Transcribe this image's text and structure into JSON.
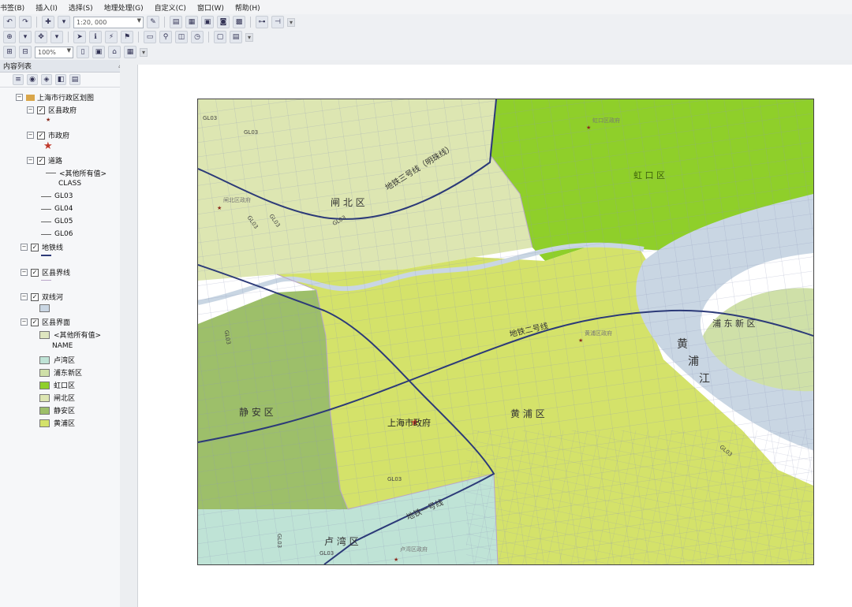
{
  "menu": [
    "书签(B)",
    "插入(I)",
    "选择(S)",
    "地理处理(G)",
    "自定义(C)",
    "窗口(W)",
    "帮助(H)"
  ],
  "toolbar": {
    "scale_value": "1:20, 000",
    "zoom_value": "100%"
  },
  "toc": {
    "title": "内容列表",
    "pin_glyph": "₄",
    "close_glyph": "×",
    "map_doc": "上海市行政区划图",
    "layers": {
      "county_gov": {
        "name": "区县政府"
      },
      "city_gov": {
        "name": "市政府"
      },
      "roads": {
        "name": "道路",
        "other_values": "<其他所有值>",
        "field": "CLASS",
        "classes": [
          "GL03",
          "GL04",
          "GL05",
          "GL06"
        ]
      },
      "metro": {
        "name": "地铁线"
      },
      "district_border": {
        "name": "区县界线"
      },
      "river": {
        "name": "双线河"
      },
      "district_area": {
        "name": "区县界面",
        "other_values": "<其他所有值>",
        "field": "NAME",
        "classes": [
          {
            "label": "卢湾区",
            "color": "#bfe3d6"
          },
          {
            "label": "浦东新区",
            "color": "#cfe0a8"
          },
          {
            "label": "虹口区",
            "color": "#8fcf2a"
          },
          {
            "label": "闸北区",
            "color": "#dde6b2"
          },
          {
            "label": "静安区",
            "color": "#9dbf6a"
          },
          {
            "label": "黄浦区",
            "color": "#d4e26a"
          }
        ]
      }
    }
  },
  "map": {
    "colors": {
      "river": "#c9d6e3",
      "metro": "#2c3a78",
      "road": "#8e96b8",
      "border": "#b9a6c9"
    },
    "district_labels": {
      "zhabei": "闸  北  区",
      "hongkou": "虹  口  区",
      "jingan": "静  安  区",
      "huangpu": "黄  浦  区",
      "pudong": "浦  东  新  区",
      "luwan": "卢  湾  区"
    },
    "river_label": [
      "黄",
      "浦",
      "江"
    ],
    "metro_labels": {
      "line3": "地铁三号线（明珠线）",
      "line2": "地铁二号线",
      "line1": "地铁一号线"
    },
    "gov_labels": {
      "zhabei": "闸北区政府",
      "hongkou": "虹口区政府",
      "huangpu": "黄浦区政府",
      "luwan": "卢湾区政府",
      "city": "上海市政府"
    },
    "road_class_label": "GL03"
  }
}
